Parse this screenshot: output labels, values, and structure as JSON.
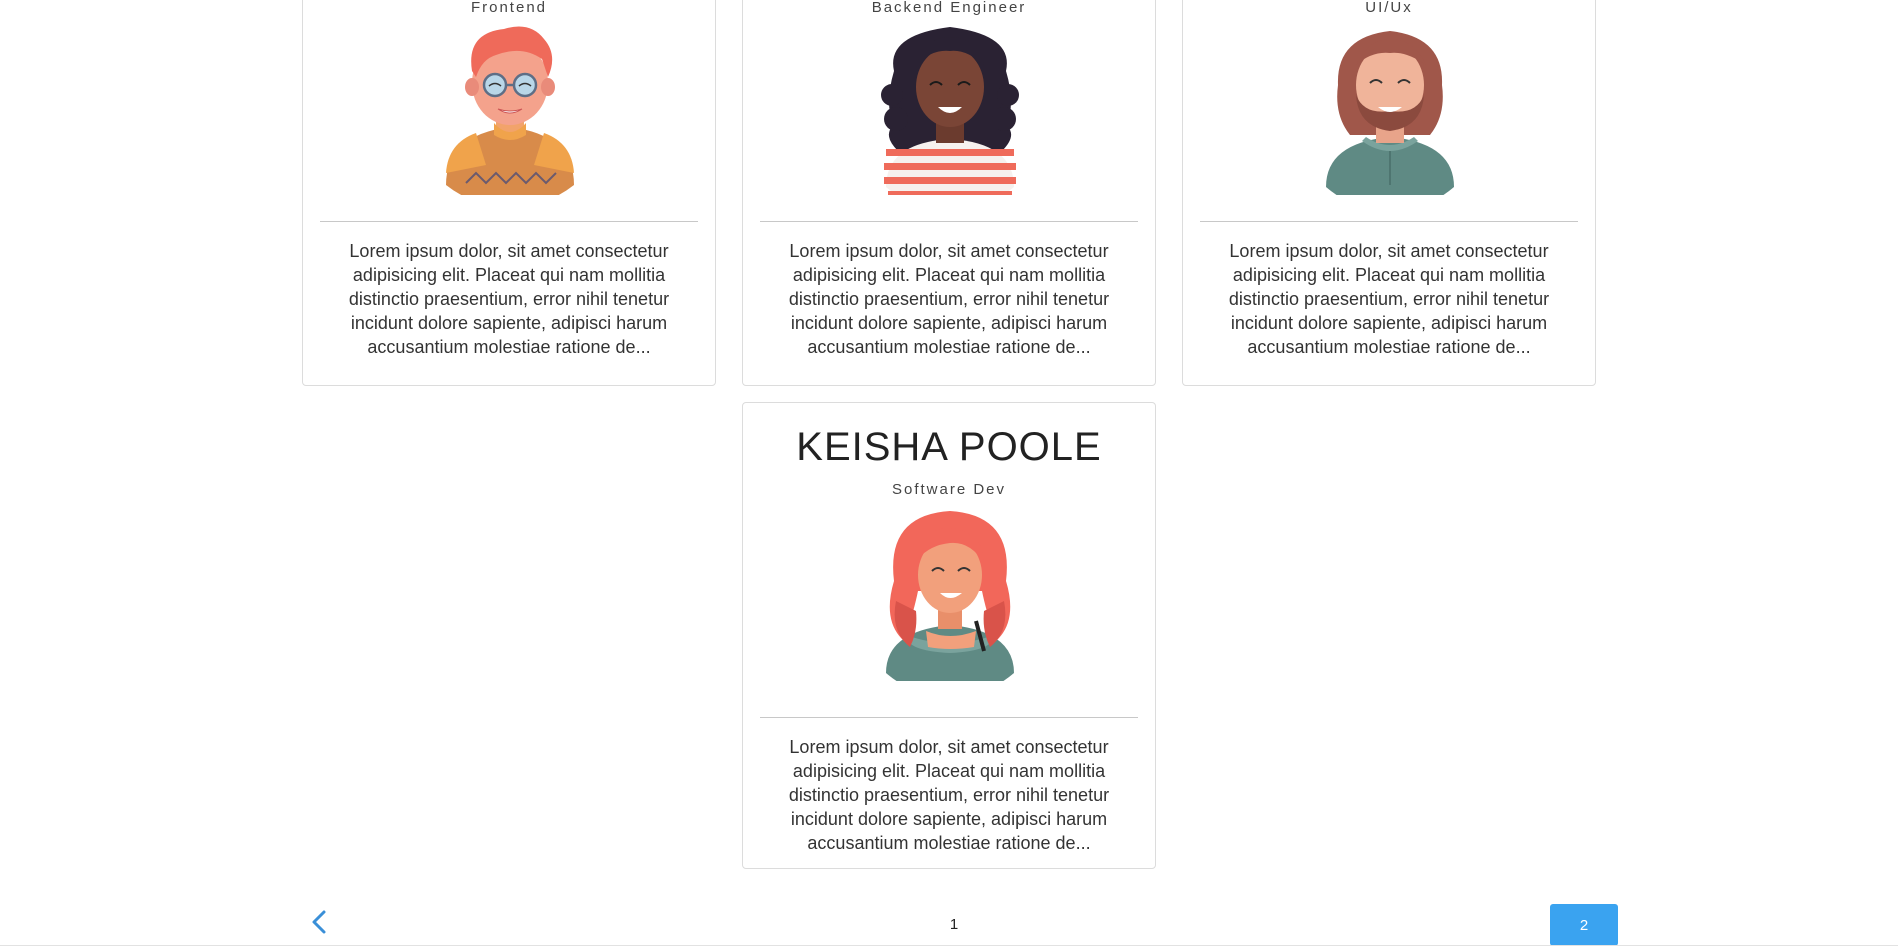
{
  "cards": [
    {
      "role": "Frontend",
      "avatar": "glasses-man-avatar",
      "description": "Lorem ipsum dolor, sit amet consectetur adipisicing elit. Placeat qui nam mollitia distinctio praesentium, error nihil tenetur incidunt dolore sapiente, adipisci harum accusantium molestiae ratione de..."
    },
    {
      "role": "Backend Engineer",
      "avatar": "curly-hair-woman-avatar",
      "description": "Lorem ipsum dolor, sit amet consectetur adipisicing elit. Placeat qui nam mollitia distinctio praesentium, error nihil tenetur incidunt dolore sapiente, adipisci harum accusantium molestiae ratione de..."
    },
    {
      "role": "UI/Ux",
      "avatar": "bearded-man-avatar",
      "description": "Lorem ipsum dolor, sit amet consectetur adipisicing elit. Placeat qui nam mollitia distinctio praesentium, error nihil tenetur incidunt dolore sapiente, adipisci harum accusantium molestiae ratione de..."
    },
    {
      "name": "KEISHA POOLE",
      "role": "Software Dev",
      "avatar": "red-hair-woman-avatar",
      "description": "Lorem ipsum dolor, sit amet consectetur adipisicing elit. Placeat qui nam mollitia distinctio praesentium, error nihil tenetur incidunt dolore sapiente, adipisci harum accusantium molestiae ratione de..."
    }
  ],
  "pagination": {
    "prev_icon": "chevron-left-icon",
    "pages": [
      "1",
      "2"
    ],
    "current": "2"
  },
  "colors": {
    "accent": "#3aa3f0",
    "border": "#dcdcdc"
  }
}
